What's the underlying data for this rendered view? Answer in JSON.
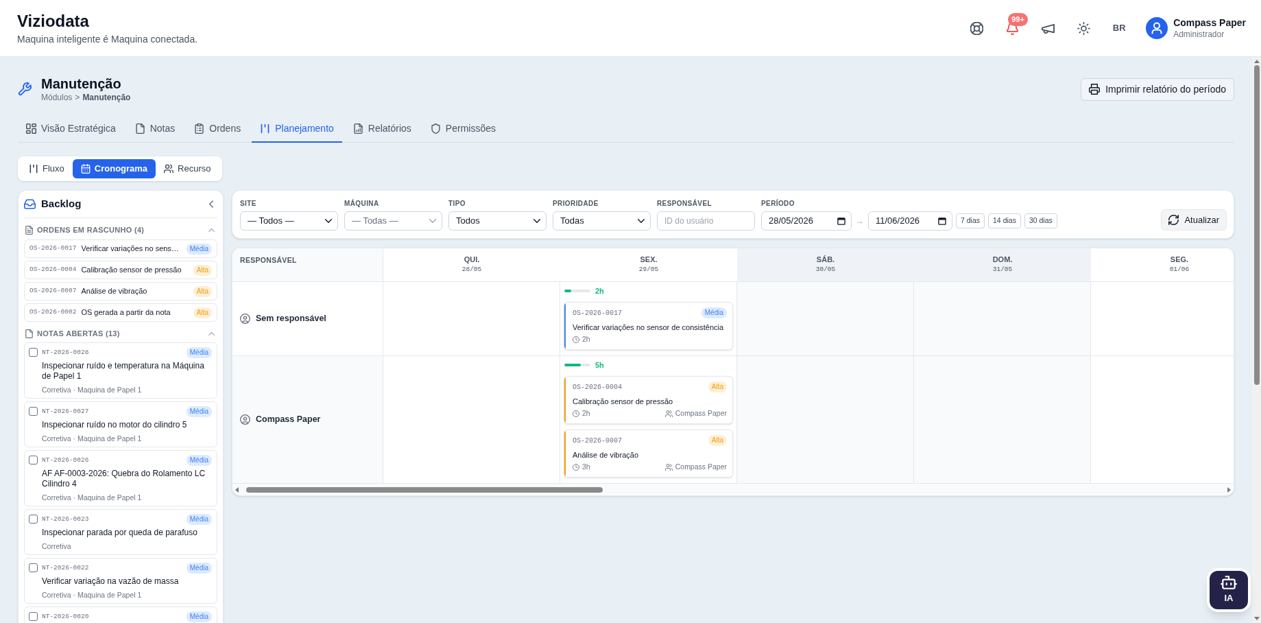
{
  "header": {
    "title": "Viziodata",
    "tagline": "Maquina inteligente é Maquina conectada.",
    "notification_badge": "99+",
    "language": "BR",
    "user": {
      "name": "Compass Paper",
      "role": "Administrador"
    }
  },
  "page": {
    "title": "Manutenção",
    "breadcrumb": {
      "parent": "Módulos",
      "separator": ">",
      "current": "Manutenção"
    },
    "print_button": "Imprimir relatório do período"
  },
  "tabs": [
    {
      "label": "Visão Estratégica",
      "selected": false
    },
    {
      "label": "Notas",
      "selected": false
    },
    {
      "label": "Ordens",
      "selected": false
    },
    {
      "label": "Planejamento",
      "selected": true
    },
    {
      "label": "Relatórios",
      "selected": false
    },
    {
      "label": "Permissões",
      "selected": false
    }
  ],
  "views": [
    {
      "label": "Fluxo",
      "selected": false
    },
    {
      "label": "Cronograma",
      "selected": true
    },
    {
      "label": "Recurso",
      "selected": false
    }
  ],
  "backlog": {
    "title": "Backlog",
    "sections": [
      {
        "kind": "orders",
        "title": "ORDENS EM RASCUNHO (4)",
        "expanded": true,
        "items": [
          {
            "code": "OS-2026-0017",
            "title": "Verificar variações no sens…",
            "badge": {
              "label": "Média",
              "color": "#3b82f6"
            }
          },
          {
            "code": "OS-2026-0004",
            "title": "Calibração sensor de pressão",
            "badge": {
              "label": "Alta",
              "color": "#f59e0b"
            }
          },
          {
            "code": "OS-2026-0007",
            "title": "Análise de vibração",
            "badge": {
              "label": "Alta",
              "color": "#f59e0b"
            }
          },
          {
            "code": "OS-2026-0002",
            "title": "OS gerada a partir da nota",
            "badge": {
              "label": "Alta",
              "color": "#f59e0b"
            }
          }
        ]
      },
      {
        "kind": "notes",
        "title": "NOTAS ABERTAS (13)",
        "expanded": true,
        "items": [
          {
            "code": "NT-2026-0028",
            "checked": false,
            "badge": {
              "label": "Média",
              "color": "#3b82f6"
            },
            "title": "Inspecionar ruído e temperatura na Máquina de Papel 1",
            "meta": "Corretiva · Maquina de Papel 1"
          },
          {
            "code": "NT-2026-0027",
            "checked": false,
            "badge": {
              "label": "Média",
              "color": "#3b82f6"
            },
            "title": "Inspecionar ruído no motor do cilindro 5",
            "meta": "Corretiva · Maquina de Papel 1"
          },
          {
            "code": "NT-2026-0026",
            "checked": false,
            "badge": {
              "label": "Média",
              "color": "#3b82f6"
            },
            "title": "AF AF-0003-2026: Quebra do Rolamento LC Cilindro 4",
            "meta": "Corretiva · Maquina de Papel 1"
          },
          {
            "code": "NT-2026-0023",
            "checked": false,
            "badge": {
              "label": "Média",
              "color": "#3b82f6"
            },
            "title": "Inspecionar parada por queda de parafuso",
            "meta": "Corretiva"
          },
          {
            "code": "NT-2026-0022",
            "checked": false,
            "badge": {
              "label": "Média",
              "color": "#3b82f6"
            },
            "title": "Verificar variação na vazão de massa",
            "meta": "Corretiva · Maquina de Papel 1"
          },
          {
            "code": "NT-2026-0020",
            "checked": false,
            "badge": {
              "label": "Média",
              "color": "#3b82f6"
            }
          }
        ]
      }
    ]
  },
  "filters": [
    {
      "kind": "select",
      "label": "SITE",
      "value": "— Todos —",
      "disabled": false
    },
    {
      "kind": "select",
      "label": "MÁQUINA",
      "value": "— Todas —",
      "disabled": true
    },
    {
      "kind": "select",
      "label": "TIPO",
      "value": "Todos",
      "disabled": false
    },
    {
      "kind": "select",
      "label": "PRIORIDADE",
      "value": "Todas",
      "disabled": false
    },
    {
      "kind": "input",
      "label": "RESPONSÁVEL",
      "placeholder": "ID do usuário"
    },
    {
      "kind": "date_range",
      "label": "PERÍODO",
      "start": "28/05/2026",
      "separator": "→",
      "end": "11/06/2026",
      "presets": [
        "7 dias",
        "14 dias",
        "30 dias"
      ]
    }
  ],
  "refresh_button": "Atualizar",
  "schedule": {
    "corner": "RESPONSÁVEL",
    "days": [
      {
        "weekday": "QUI.",
        "date": "28/05",
        "weekend": false
      },
      {
        "weekday": "SEX.",
        "date": "29/05",
        "weekend": false
      },
      {
        "weekday": "SÁB.",
        "date": "30/05",
        "weekend": true
      },
      {
        "weekday": "DOM.",
        "date": "31/05",
        "weekend": true
      },
      {
        "weekday": "SEG.",
        "date": "01/06",
        "weekend": false
      }
    ],
    "rows": [
      {
        "name": "Sem responsável",
        "cells": [
          {},
          {
            "load": "2h",
            "level": 0.25,
            "orders": [
              {
                "code": "OS-2026-0017",
                "badge": {
                  "label": "Média",
                  "color": "#3b82f6"
                },
                "title": "Verificar variações no sensor de consistência",
                "duration": "2h"
              }
            ]
          },
          {},
          {},
          {}
        ]
      },
      {
        "name": "Compass Paper",
        "cells": [
          {},
          {
            "load": "5h",
            "level": 0.625,
            "orders": [
              {
                "code": "OS-2026-0004",
                "badge": {
                  "label": "Alta",
                  "color": "#f59e0b"
                },
                "title": "Calibração sensor de pressão",
                "duration": "2h",
                "assignee": "Compass Paper"
              },
              {
                "code": "OS-2026-0007",
                "badge": {
                  "label": "Alta",
                  "color": "#f59e0b"
                },
                "title": "Análise de vibração",
                "duration": "3h",
                "assignee": "Compass Paper"
              }
            ]
          },
          {},
          {},
          {}
        ]
      }
    ]
  },
  "ai_button": "IA"
}
